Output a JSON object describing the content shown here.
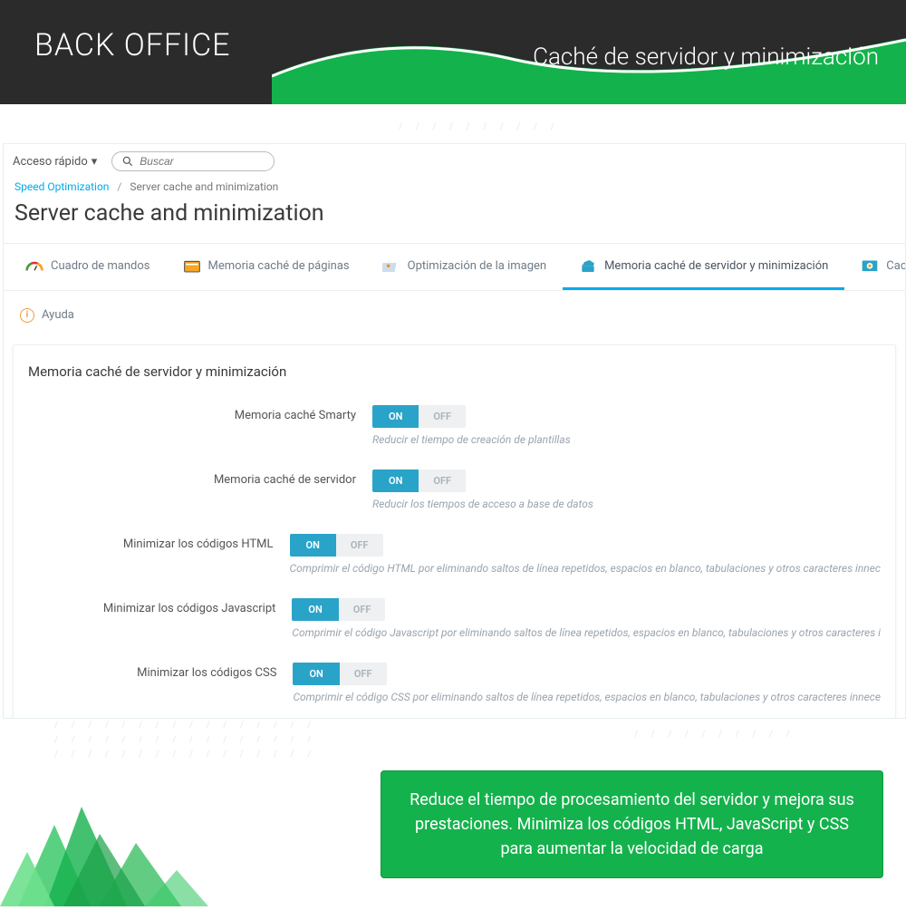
{
  "banner": {
    "title": "BACK OFFICE",
    "subtitle": "Caché de servidor y minimización"
  },
  "topbar": {
    "quick_access": "Acceso rápido",
    "search_placeholder": "Buscar"
  },
  "breadcrumb": {
    "root": "Speed Optimization",
    "current": "Server cache and minimization"
  },
  "page_title": "Server cache and minimization",
  "tabs": [
    {
      "label": "Cuadro de mandos"
    },
    {
      "label": "Memoria caché de páginas"
    },
    {
      "label": "Optimización de la imagen"
    },
    {
      "label": "Memoria caché de servidor y minimización",
      "active": true
    },
    {
      "label": "Caché d"
    }
  ],
  "help_label": "Ayuda",
  "card": {
    "title": "Memoria caché de servidor y minimización",
    "on": "ON",
    "off": "OFF",
    "rows": [
      {
        "label": "Memoria caché Smarty",
        "hint": "Reducir el tiempo de creación de plantillas"
      },
      {
        "label": "Memoria caché de servidor",
        "hint": "Reducir los tiempos de acceso a base de datos"
      },
      {
        "label": "Minimizar los códigos HTML",
        "hint": "Comprimir el código HTML por eliminando saltos de línea repetidos, espacios en blanco, tabulaciones y otros caracteres innec"
      },
      {
        "label": "Minimizar los códigos Javascript",
        "hint": "Comprimir el código Javascript por eliminando saltos de línea repetidos, espacios en blanco, tabulaciones y otros caracteres i"
      },
      {
        "label": "Minimizar los códigos CSS",
        "hint": "Comprimir el código CSS por eliminando saltos de línea repetidos, espacios en blanco, tabulaciones y otros caracteres innece"
      }
    ]
  },
  "callout": "Reduce el tiempo de procesamiento del servidor y mejora sus prestaciones. Minimiza los códigos HTML, JavaScript y CSS para aumentar la velocidad de carga"
}
